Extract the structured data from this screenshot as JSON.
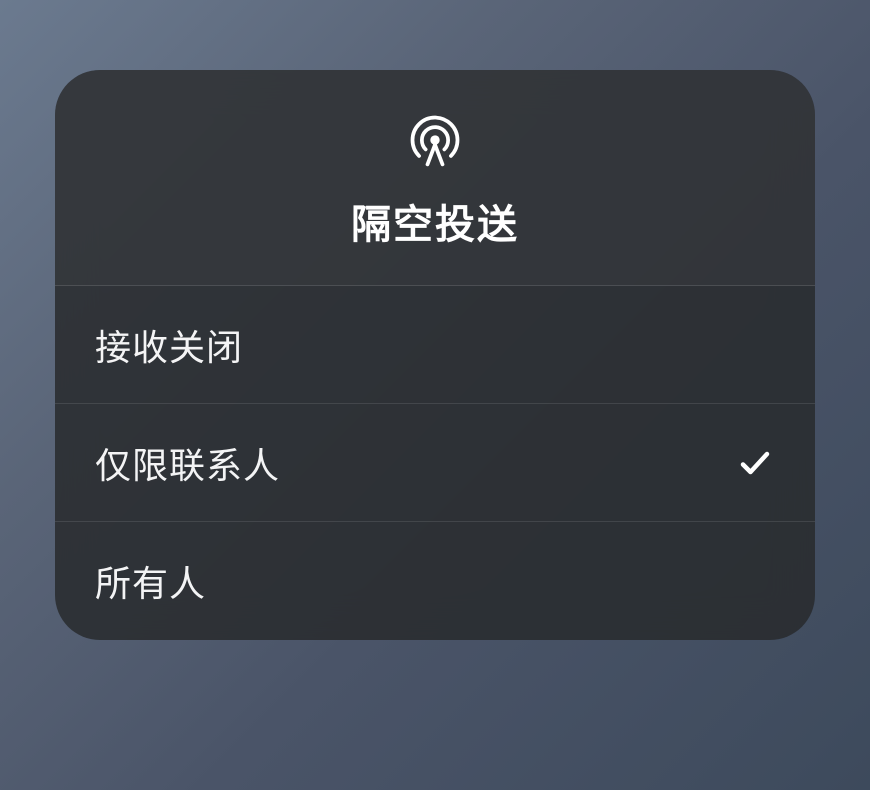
{
  "header": {
    "title": "隔空投送",
    "iconName": "airdrop-icon"
  },
  "options": [
    {
      "label": "接收关闭",
      "selected": false
    },
    {
      "label": "仅限联系人",
      "selected": true
    },
    {
      "label": "所有人",
      "selected": false
    }
  ]
}
